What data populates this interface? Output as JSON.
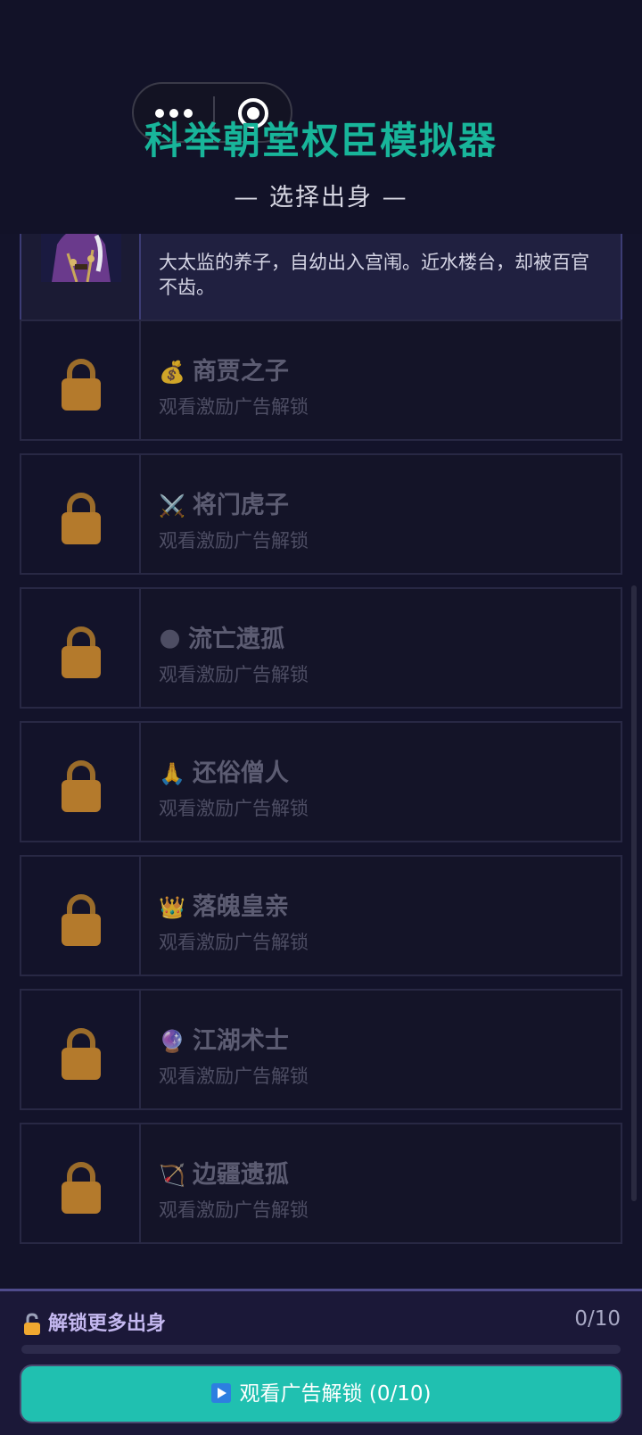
{
  "app": {
    "title": "科举朝堂权臣模拟器",
    "subtitle": "— 选择出身 —"
  },
  "selected": {
    "description": "大太监的养子，自幼出入宫闱。近水楼台，却被百官不齿。"
  },
  "origins": [
    {
      "icon": "💰",
      "name": "商贾之子",
      "hint": "观看激励广告解锁"
    },
    {
      "icon": "⚔️",
      "name": "将门虎子",
      "hint": "观看激励广告解锁"
    },
    {
      "icon": "🌑",
      "name": "流亡遗孤",
      "hint": "观看激励广告解锁"
    },
    {
      "icon": "🙏",
      "name": "还俗僧人",
      "hint": "观看激励广告解锁"
    },
    {
      "icon": "👑",
      "name": "落魄皇亲",
      "hint": "观看激励广告解锁"
    },
    {
      "icon": "🔮",
      "name": "江湖术士",
      "hint": "观看激励广告解锁"
    },
    {
      "icon": "🏹",
      "name": "边疆遗孤",
      "hint": "观看激励广告解锁"
    }
  ],
  "unlock": {
    "title": "解锁更多出身",
    "count": "0/10",
    "progress": 0,
    "button_label": "观看广告解锁 (0/10)"
  },
  "colors": {
    "accent": "#20c0b0",
    "lock": "#b47a2c",
    "background": "#13132a"
  }
}
